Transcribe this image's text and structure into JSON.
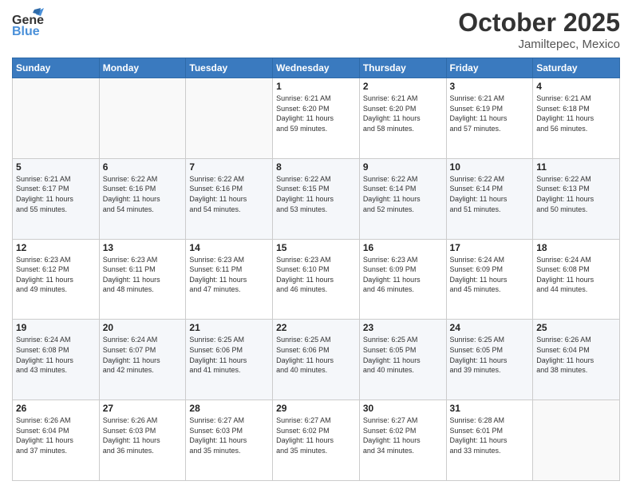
{
  "logo": {
    "name": "General",
    "name2": "Blue"
  },
  "title": "October 2025",
  "subtitle": "Jamiltepec, Mexico",
  "header_days": [
    "Sunday",
    "Monday",
    "Tuesday",
    "Wednesday",
    "Thursday",
    "Friday",
    "Saturday"
  ],
  "weeks": [
    [
      {
        "day": "",
        "info": ""
      },
      {
        "day": "",
        "info": ""
      },
      {
        "day": "",
        "info": ""
      },
      {
        "day": "1",
        "info": "Sunrise: 6:21 AM\nSunset: 6:20 PM\nDaylight: 11 hours\nand 59 minutes."
      },
      {
        "day": "2",
        "info": "Sunrise: 6:21 AM\nSunset: 6:20 PM\nDaylight: 11 hours\nand 58 minutes."
      },
      {
        "day": "3",
        "info": "Sunrise: 6:21 AM\nSunset: 6:19 PM\nDaylight: 11 hours\nand 57 minutes."
      },
      {
        "day": "4",
        "info": "Sunrise: 6:21 AM\nSunset: 6:18 PM\nDaylight: 11 hours\nand 56 minutes."
      }
    ],
    [
      {
        "day": "5",
        "info": "Sunrise: 6:21 AM\nSunset: 6:17 PM\nDaylight: 11 hours\nand 55 minutes."
      },
      {
        "day": "6",
        "info": "Sunrise: 6:22 AM\nSunset: 6:16 PM\nDaylight: 11 hours\nand 54 minutes."
      },
      {
        "day": "7",
        "info": "Sunrise: 6:22 AM\nSunset: 6:16 PM\nDaylight: 11 hours\nand 54 minutes."
      },
      {
        "day": "8",
        "info": "Sunrise: 6:22 AM\nSunset: 6:15 PM\nDaylight: 11 hours\nand 53 minutes."
      },
      {
        "day": "9",
        "info": "Sunrise: 6:22 AM\nSunset: 6:14 PM\nDaylight: 11 hours\nand 52 minutes."
      },
      {
        "day": "10",
        "info": "Sunrise: 6:22 AM\nSunset: 6:14 PM\nDaylight: 11 hours\nand 51 minutes."
      },
      {
        "day": "11",
        "info": "Sunrise: 6:22 AM\nSunset: 6:13 PM\nDaylight: 11 hours\nand 50 minutes."
      }
    ],
    [
      {
        "day": "12",
        "info": "Sunrise: 6:23 AM\nSunset: 6:12 PM\nDaylight: 11 hours\nand 49 minutes."
      },
      {
        "day": "13",
        "info": "Sunrise: 6:23 AM\nSunset: 6:11 PM\nDaylight: 11 hours\nand 48 minutes."
      },
      {
        "day": "14",
        "info": "Sunrise: 6:23 AM\nSunset: 6:11 PM\nDaylight: 11 hours\nand 47 minutes."
      },
      {
        "day": "15",
        "info": "Sunrise: 6:23 AM\nSunset: 6:10 PM\nDaylight: 11 hours\nand 46 minutes."
      },
      {
        "day": "16",
        "info": "Sunrise: 6:23 AM\nSunset: 6:09 PM\nDaylight: 11 hours\nand 46 minutes."
      },
      {
        "day": "17",
        "info": "Sunrise: 6:24 AM\nSunset: 6:09 PM\nDaylight: 11 hours\nand 45 minutes."
      },
      {
        "day": "18",
        "info": "Sunrise: 6:24 AM\nSunset: 6:08 PM\nDaylight: 11 hours\nand 44 minutes."
      }
    ],
    [
      {
        "day": "19",
        "info": "Sunrise: 6:24 AM\nSunset: 6:08 PM\nDaylight: 11 hours\nand 43 minutes."
      },
      {
        "day": "20",
        "info": "Sunrise: 6:24 AM\nSunset: 6:07 PM\nDaylight: 11 hours\nand 42 minutes."
      },
      {
        "day": "21",
        "info": "Sunrise: 6:25 AM\nSunset: 6:06 PM\nDaylight: 11 hours\nand 41 minutes."
      },
      {
        "day": "22",
        "info": "Sunrise: 6:25 AM\nSunset: 6:06 PM\nDaylight: 11 hours\nand 40 minutes."
      },
      {
        "day": "23",
        "info": "Sunrise: 6:25 AM\nSunset: 6:05 PM\nDaylight: 11 hours\nand 40 minutes."
      },
      {
        "day": "24",
        "info": "Sunrise: 6:25 AM\nSunset: 6:05 PM\nDaylight: 11 hours\nand 39 minutes."
      },
      {
        "day": "25",
        "info": "Sunrise: 6:26 AM\nSunset: 6:04 PM\nDaylight: 11 hours\nand 38 minutes."
      }
    ],
    [
      {
        "day": "26",
        "info": "Sunrise: 6:26 AM\nSunset: 6:04 PM\nDaylight: 11 hours\nand 37 minutes."
      },
      {
        "day": "27",
        "info": "Sunrise: 6:26 AM\nSunset: 6:03 PM\nDaylight: 11 hours\nand 36 minutes."
      },
      {
        "day": "28",
        "info": "Sunrise: 6:27 AM\nSunset: 6:03 PM\nDaylight: 11 hours\nand 35 minutes."
      },
      {
        "day": "29",
        "info": "Sunrise: 6:27 AM\nSunset: 6:02 PM\nDaylight: 11 hours\nand 35 minutes."
      },
      {
        "day": "30",
        "info": "Sunrise: 6:27 AM\nSunset: 6:02 PM\nDaylight: 11 hours\nand 34 minutes."
      },
      {
        "day": "31",
        "info": "Sunrise: 6:28 AM\nSunset: 6:01 PM\nDaylight: 11 hours\nand 33 minutes."
      },
      {
        "day": "",
        "info": ""
      }
    ]
  ]
}
